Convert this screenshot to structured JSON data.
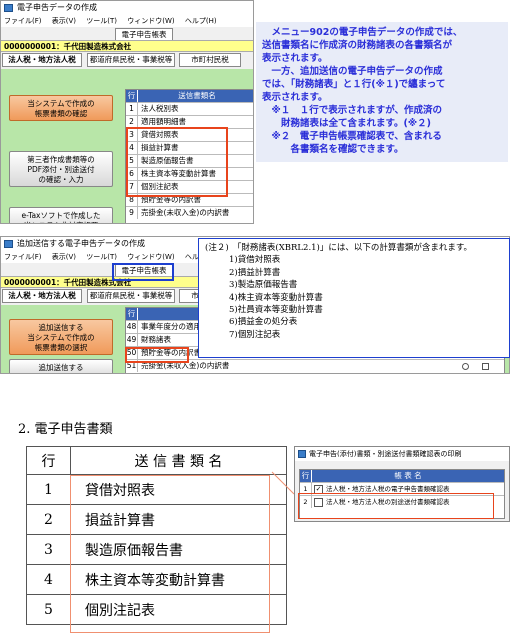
{
  "top_window": {
    "title": "電子申告データの作成",
    "menu": [
      "ファイル(F)",
      "表示(V)",
      "ツール(T)",
      "ウィンドウ(W)",
      "ヘルプ(H)"
    ],
    "main_tab": "電子申告帳表",
    "company": "0000000001：千代田製造株式会社",
    "subtabs": [
      "法人税・地方法人税",
      "都道府県民税・事業税等",
      "市町村民税"
    ],
    "buttons": [
      "当システムで作成の\n帳票書類の確認",
      "第三者作成書類等の\nPDF添付・別途送付\nの確認・入力",
      "e-Taxソフトで作成した\n当システム非対応帳票"
    ],
    "grid_header": {
      "num": "行",
      "name": "送信書類名"
    },
    "rows": [
      {
        "num": "1",
        "name": "法人税別表"
      },
      {
        "num": "2",
        "name": "適用額明細書"
      },
      {
        "num": "3",
        "name": "貸借対照表"
      },
      {
        "num": "4",
        "name": "損益計算書"
      },
      {
        "num": "5",
        "name": "製造原価報告書"
      },
      {
        "num": "6",
        "name": "株主資本等変動計算書"
      },
      {
        "num": "7",
        "name": "個別注記表"
      },
      {
        "num": "8",
        "name": "預貯金等の内訳書"
      },
      {
        "num": "9",
        "name": "売掛金(未収入金)の内訳書"
      }
    ]
  },
  "note1": {
    "lines": [
      "　メニュー902の電子申告データの作成では、",
      "送信書類名に作成済の財務諸表の各書類名が",
      "表示されます。",
      "　一方、追加送信の電子申告データの作成",
      "では、「財務諸表」と１行(※１)で纏まって",
      "表示されます。",
      "　※１　１行で表示されますが、作成済の",
      "　　財務諸表は全て含まれます。(※２)",
      "　※２　電子申告帳票確認表で、含まれる",
      "　　　各書類名を確認できます。"
    ]
  },
  "second_window": {
    "title": "追加送信する電子申告データの作成",
    "menu": [
      "ファイル(F)",
      "表示(V)",
      "ツール(T)",
      "ウィンドウ(W)",
      "ヘルプ(H)"
    ],
    "main_tab": "電子申告帳表",
    "company": "0000000001：千代田製造株式会社",
    "subtabs": [
      "法人税・地方法人税",
      "都道府県民税・事業税等",
      "市町村民税"
    ],
    "buttons": [
      "追加送信する\n当システムで作成の\n帳票書類の選択",
      "追加送信する"
    ],
    "grid_header": {
      "num": "行"
    },
    "rows": [
      {
        "num": "48",
        "name": "事業年度分の適用"
      },
      {
        "num": "49",
        "name": "財務諸表"
      },
      {
        "num": "50",
        "name": "預貯金等の内訳書"
      },
      {
        "num": "51",
        "name": "売掛金(未収入金)の内訳書"
      }
    ]
  },
  "note2": {
    "header": "(注２)　「財務諸表(XBRL2.1)」には、以下の計算書類が含まれます。",
    "items": [
      "1)貸借対照表",
      "2)損益計算書",
      "3)製造原価報告書",
      "4)株主資本等変動計算書",
      "5)社員資本等変動計算書",
      "6)損益金の処分表",
      "7)個別注記表"
    ]
  },
  "section": {
    "title": "2. 電子申告書類",
    "header": {
      "num": "行",
      "name": "送 信 書 類 名"
    },
    "rows": [
      {
        "num": "1",
        "name": "貸借対照表"
      },
      {
        "num": "2",
        "name": "損益計算書"
      },
      {
        "num": "3",
        "name": "製造原価報告書"
      },
      {
        "num": "4",
        "name": "株主資本等変動計算書"
      },
      {
        "num": "5",
        "name": "個別注記表"
      }
    ]
  },
  "print_window": {
    "title": "電子申告(添付)書類・別途送付書類確認表の印刷",
    "header": {
      "num": "行",
      "name": "帳 表 名"
    },
    "rows": [
      {
        "num": "1",
        "name": "法人税・地方法人税の電子申告書類確認表",
        "checked": true
      },
      {
        "num": "2",
        "name": "法人税・地方法人税の別途送付書類確認表",
        "checked": false
      }
    ]
  }
}
